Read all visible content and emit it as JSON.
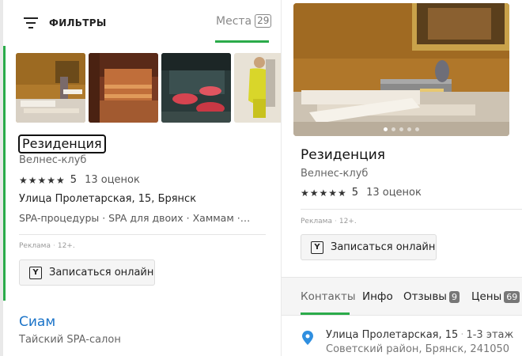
{
  "header": {
    "filters_label": "ФИЛЬТРЫ",
    "places_label": "Места",
    "places_count": "29"
  },
  "card1": {
    "title": "Резиденция",
    "category": "Велнес-клуб",
    "stars": "★★★★★",
    "rating": "5",
    "reviews": "13 оценок",
    "address": "Улица Пролетарская, 15, Брянск",
    "features": "SPA-процедуры · SPA для двоих · Хаммам ·…",
    "ad_label": "Реклама",
    "ad_separator": "·",
    "age_label": "12+.",
    "book_button": "Записаться онлайн"
  },
  "card2": {
    "title": "Сиам",
    "category": "Тайский SPA-салон"
  },
  "detail": {
    "title": "Резиденция",
    "category": "Велнес-клуб",
    "stars": "★★★★★",
    "rating": "5",
    "reviews": "13 оценок",
    "ad_label": "Реклама",
    "ad_separator": "·",
    "age_label": "12+.",
    "book_button": "Записаться онлайн",
    "tabs": [
      {
        "label": "Контакты"
      },
      {
        "label": "Инфо"
      },
      {
        "label": "Отзывы",
        "badge": "9"
      },
      {
        "label": "Цены",
        "badge": "69"
      }
    ],
    "address": "Улица Пролетарская, 15",
    "address_separator": "·",
    "floor": "1-3 этаж",
    "district": "Советский район, Брянск, 241050"
  },
  "colors": {
    "accent_green": "#2bab4a",
    "link_blue": "#1a73c8"
  },
  "icons": {
    "filter": "filter-lines-icon",
    "book": "booking-y-icon",
    "pin": "location-pin-icon"
  }
}
